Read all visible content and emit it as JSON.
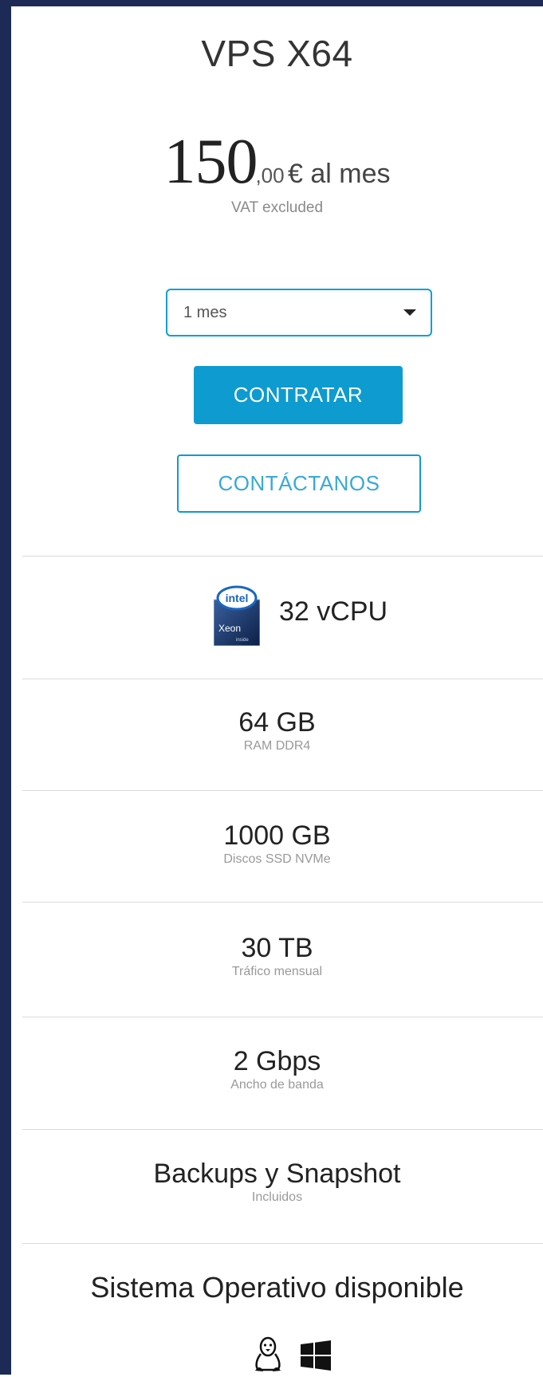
{
  "plan": {
    "title": "VPS X64",
    "price_integer": "150",
    "price_decimal": ",00",
    "price_suffix": "€ al mes",
    "vat_note": "VAT excluded"
  },
  "billing_period": {
    "selected": "1 mes"
  },
  "actions": {
    "primary_label": "CONTRATAR",
    "secondary_label": "CONTÁCTANOS"
  },
  "cpu": {
    "icon": "intel-xeon-icon",
    "value": "32 vCPU"
  },
  "specs": [
    {
      "value": "64 GB",
      "label": "RAM DDR4"
    },
    {
      "value": "1000 GB",
      "label": "Discos SSD NVMe"
    },
    {
      "value": "30 TB",
      "label": "Tráfico mensual"
    },
    {
      "value": "2 Gbps",
      "label": "Ancho de banda"
    },
    {
      "value": "Backups y Snapshot",
      "label": "Incluidos"
    }
  ],
  "os": {
    "title": "Sistema Operativo disponible",
    "icons": [
      "linux-icon",
      "windows-icon"
    ]
  },
  "colors": {
    "accent": "#0d9bd0",
    "frame": "#1c2a55"
  }
}
